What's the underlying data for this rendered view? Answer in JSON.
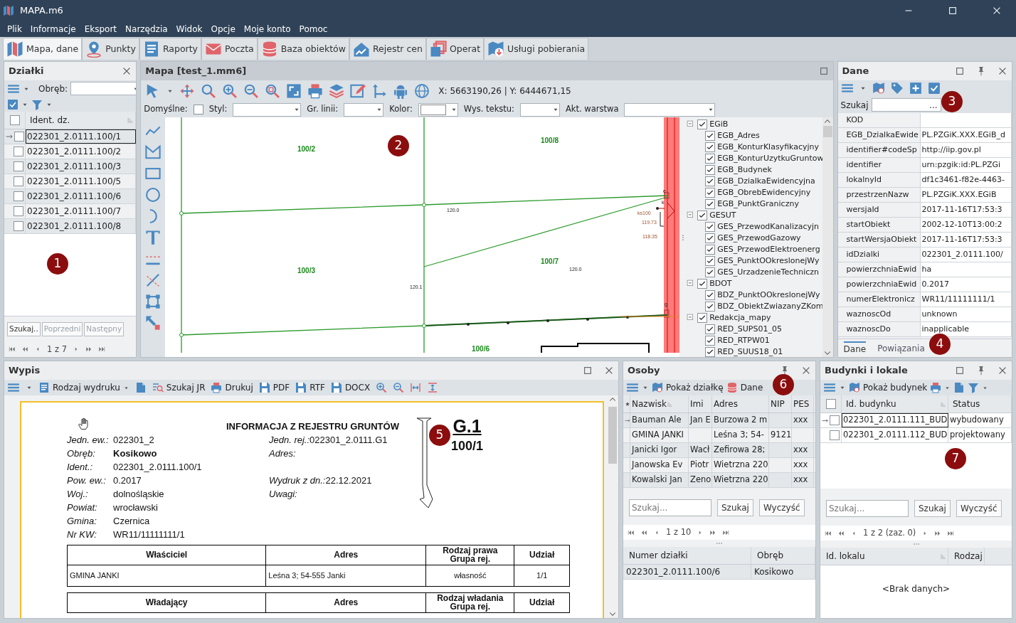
{
  "window": {
    "title": "MAPA.m6"
  },
  "menu": [
    "Plik",
    "Informacje",
    "Eksport",
    "Narzędzia",
    "Widok",
    "Opcje",
    "Moje konto",
    "Pomoc"
  ],
  "ribbon_tabs": [
    {
      "label": "Mapa, dane",
      "kind": "map",
      "selected": true
    },
    {
      "label": "Punkty",
      "kind": "pin",
      "selected": false
    },
    {
      "label": "Raporty",
      "kind": "report",
      "selected": false
    },
    {
      "label": "Poczta",
      "kind": "mail",
      "selected": false
    },
    {
      "label": "Baza obiektów",
      "kind": "database",
      "selected": false
    },
    {
      "label": "Rejestr cen",
      "kind": "chart",
      "selected": false
    },
    {
      "label": "Operat",
      "kind": "copies",
      "selected": false
    },
    {
      "label": "Usługi pobierania",
      "kind": "download",
      "selected": false
    }
  ],
  "dzialki": {
    "title": "Działki",
    "obreb_label": "Obręb:",
    "column": "Ident. dz.",
    "all_checked": false,
    "rows": [
      {
        "id": "022301_2.0111.100/1",
        "selected": true,
        "checked": false
      },
      {
        "id": "022301_2.0111.100/2",
        "selected": false,
        "checked": false
      },
      {
        "id": "022301_2.0111.100/3",
        "selected": false,
        "checked": false
      },
      {
        "id": "022301_2.0111.100/5",
        "selected": false,
        "checked": false
      },
      {
        "id": "022301_2.0111.100/6",
        "selected": false,
        "checked": false
      },
      {
        "id": "022301_2.0111.100/7",
        "selected": false,
        "checked": false
      },
      {
        "id": "022301_2.0111.100/8",
        "selected": false,
        "checked": false
      }
    ],
    "buttons": [
      {
        "label": "Szukaj..",
        "disabled": false
      },
      {
        "label": "Poprzedni",
        "disabled": true
      },
      {
        "label": "Następny",
        "disabled": true
      }
    ],
    "pager": "1 z 7"
  },
  "map": {
    "title": "Mapa [test_1.mm6]",
    "coords": "X: 5663190,26 | Y: 6444671,15",
    "fields": [
      {
        "label": "Domyślne:",
        "kind": "checkbox",
        "checked": false
      },
      {
        "label": "Styl:",
        "kind": "select"
      },
      {
        "label": "Gr. linii:",
        "kind": "select"
      },
      {
        "label": "Kolor:",
        "kind": "color"
      },
      {
        "label": "Wys. tekstu:",
        "kind": "select"
      },
      {
        "label": "Akt. warstwa",
        "kind": "select"
      }
    ],
    "labels": [
      {
        "text": "100/2",
        "kind": "parcel"
      },
      {
        "text": "100/8",
        "kind": "parcel"
      },
      {
        "text": "100/3",
        "kind": "parcel"
      },
      {
        "text": "100/7",
        "kind": "parcel"
      },
      {
        "text": "100/6",
        "kind": "parcel"
      },
      {
        "text": "120.0",
        "kind": "height"
      },
      {
        "text": "120.1",
        "kind": "height"
      },
      {
        "text": "120.0",
        "kind": "height"
      },
      {
        "text": "ks100",
        "kind": "utility"
      },
      {
        "text": "119.73",
        "kind": "utility"
      },
      {
        "text": "118.35",
        "kind": "utility"
      },
      {
        "text": "e",
        "kind": "height"
      },
      {
        "text": "k",
        "kind": "height"
      },
      {
        "text": "g",
        "kind": "height"
      }
    ],
    "layers": [
      {
        "label": "EGiB",
        "checked": true,
        "expanded": true,
        "children": [
          {
            "label": "EGB_Adres",
            "checked": true
          },
          {
            "label": "EGB_KonturKlasyfikacyjny",
            "checked": true
          },
          {
            "label": "EGB_KonturUzytkuGruntow",
            "checked": true
          },
          {
            "label": "EGB_Budynek",
            "checked": true
          },
          {
            "label": "EGB_DzialkaEwidencyjna",
            "checked": true
          },
          {
            "label": "EGB_ObrebEwidencyjny",
            "checked": true
          },
          {
            "label": "EGB_PunktGraniczny",
            "checked": true
          }
        ]
      },
      {
        "label": "GESUT",
        "checked": true,
        "expanded": true,
        "children": [
          {
            "label": "GES_PrzewodKanalizacyjn",
            "checked": true
          },
          {
            "label": "GES_PrzewodGazowy",
            "checked": true
          },
          {
            "label": "GES_PrzewodElektroenerg",
            "checked": true
          },
          {
            "label": "GES_PunktOOkreslonejWy",
            "checked": true
          },
          {
            "label": "GES_UrzadzenieTechniczn",
            "checked": true
          }
        ]
      },
      {
        "label": "BDOT",
        "checked": true,
        "expanded": true,
        "children": [
          {
            "label": "BDZ_PunktOOkreslonejWy",
            "checked": true
          },
          {
            "label": "BDZ_ObiektZwiazanyZKom",
            "checked": true
          }
        ]
      },
      {
        "label": "Redakcja_mapy",
        "checked": true,
        "expanded": true,
        "children": [
          {
            "label": "RED_SUPS01_05",
            "checked": true
          },
          {
            "label": "RED_RTPW01",
            "checked": true
          },
          {
            "label": "RED_SUUS18_01",
            "checked": true
          }
        ]
      }
    ]
  },
  "dane": {
    "title": "Dane",
    "search_label": "Szukaj",
    "search_button": "...",
    "rows": [
      {
        "name": "KOD"
      },
      {
        "name": "EGB_DzialkaEwide",
        "value": "PL.PZGiK.XXX.EGiB_d"
      },
      {
        "name": "identifier#codeSp",
        "value": "http://iip.gov.pl"
      },
      {
        "name": "identifier",
        "value": "urn:pzgik:id:PL.PZGi"
      },
      {
        "name": "lokalnyId",
        "value": "df1c3461-f82e-4463-"
      },
      {
        "name": "przestrzenNazw",
        "value": "PL.PZGiK.XXX.EGiB"
      },
      {
        "name": "wersjaId",
        "value": "2017-11-16T17:53:3"
      },
      {
        "name": "startObiekt",
        "value": "2002-12-10T13:00:2"
      },
      {
        "name": "startWersjaObiekt",
        "value": "2017-11-16T17:53:3"
      },
      {
        "name": "idDzialki",
        "value": "022301_2.0111.100/"
      },
      {
        "name": "powierzchniaEwid",
        "value": "ha"
      },
      {
        "name": "powierzchniaEwid",
        "value": "0.2017"
      },
      {
        "name": "numerElektronicz",
        "value": "WR11/11111111/1"
      },
      {
        "name": "waznoscOd",
        "value": "unknown"
      },
      {
        "name": "waznoscDo",
        "value": "inapplicable"
      }
    ],
    "tabs": [
      {
        "label": "Dane",
        "selected": true
      },
      {
        "label": "Powiązania",
        "selected": false
      }
    ]
  },
  "wypis": {
    "title": "Wypis",
    "toolbar": [
      {
        "label": "Rodzaj wydruku",
        "kind": "report",
        "caret": true
      },
      {
        "label": "Szukaj JR",
        "kind": "search-doc",
        "caret": false
      },
      {
        "label": "Drukuj",
        "kind": "print",
        "caret": false
      },
      {
        "label": "PDF",
        "kind": "save",
        "caret": false
      },
      {
        "label": "RTF",
        "kind": "save",
        "caret": false
      },
      {
        "label": "DOCX",
        "kind": "save",
        "caret": false
      }
    ],
    "document": {
      "heading": "INFORMACJA Z REJESTRU GRUNTÓW",
      "sheet": "G.1",
      "parcel": "100/1",
      "left": [
        {
          "label": "Jedn. ew.:",
          "value": "022301_2"
        },
        {
          "label": "Obręb:",
          "value": "Kosikowo",
          "bold": true
        },
        {
          "label": "Ident.:",
          "value": "022301_2.0111.100/1"
        },
        {
          "label": "Pow. ew.:",
          "value": "0.2017"
        },
        {
          "label": "Woj.:",
          "value": "dolnośląskie"
        },
        {
          "label": "Powiat:",
          "value": "wrocławski"
        },
        {
          "label": "Gmina:",
          "value": "Czernica"
        },
        {
          "label": "Nr KW:",
          "value": "WR11/11111111/1"
        }
      ],
      "right": [
        {
          "label": "Jedn. rej.:",
          "value": "022301_2.0111.G1"
        },
        {
          "label": "Adres:"
        },
        {
          "label": "Wydruk z dn.:",
          "value": "22.12.2021"
        },
        {
          "label": "Uwagi:"
        }
      ],
      "tables": [
        {
          "columns": [
            "Właściciel",
            "Adres",
            "Rodzaj prawa\nGrupa rej.",
            "Udział"
          ],
          "rows": [
            [
              "GMINA JANKI",
              "Leśna 3; 54-555 Janki",
              "własność",
              "1/1"
            ]
          ]
        },
        {
          "columns": [
            "Władający",
            "Adres",
            "Rodzaj władania\nGrupa rej.",
            "Udział"
          ]
        }
      ]
    }
  },
  "osoby": {
    "title": "Osoby",
    "toolbar": [
      "Pokaż działkę",
      "Dane"
    ],
    "columns": [
      "Nazwisk",
      "Imi",
      "Adres",
      "NIP",
      "PES"
    ],
    "rows": [
      {
        "selected": true,
        "cells": {
          "surname": "Bauman  Ale",
          "name": "Jan E",
          "address": "Burzowa 2 m",
          "pesel": "xxx"
        }
      },
      {
        "selected": false,
        "cells": {
          "surname": "GMINA JANKI",
          "address": "Leśna 3; 54-",
          "nip": "9121"
        }
      },
      {
        "selected": false,
        "cells": {
          "surname": "Janicki  Igor",
          "name": "Wacł",
          "address": "Zefirowa 28;",
          "pesel": "xxx"
        }
      },
      {
        "selected": false,
        "cells": {
          "surname": "Janowska  Ev",
          "name": "Piotr",
          "address": "Wietrzna 220",
          "pesel": "xxx"
        }
      },
      {
        "selected": false,
        "cells": {
          "surname": "Kowalski  Jan",
          "name": "Zeno",
          "address": "Wietrzna 220",
          "pesel": "xxx"
        }
      }
    ],
    "search_placeholder": "Szukaj...",
    "buttons": [
      "Szukaj",
      "Wyczyść"
    ],
    "pager": "1 z 10",
    "sub_columns": [
      "Numer działki",
      "Obręb"
    ],
    "sub_rows": [
      [
        "022301_2.0111.100/6",
        "Kosikowo"
      ]
    ]
  },
  "budynki": {
    "title": "Budynki i lokale",
    "toolbar": [
      "Pokaż budynek"
    ],
    "columns": [
      "Id. budynku",
      "Status"
    ],
    "all_checked": false,
    "rows": [
      {
        "id": "022301_2.0111.111_BUD",
        "status": "wybudowany",
        "selected": true,
        "checked": false
      },
      {
        "id": "022301_2.0111.112_BUD",
        "status": "projektowany",
        "selected": false,
        "checked": false
      }
    ],
    "search_placeholder": "Szukaj...",
    "buttons": [
      "Szukaj",
      "Wyczyść"
    ],
    "pager": "1 z 2 (zaz. 0)",
    "sub_columns": [
      "Id. lokalu",
      "Rodzaj"
    ],
    "empty": "<Brak danych>"
  },
  "markers": [
    "1",
    "2",
    "3",
    "4",
    "5",
    "6",
    "7"
  ]
}
